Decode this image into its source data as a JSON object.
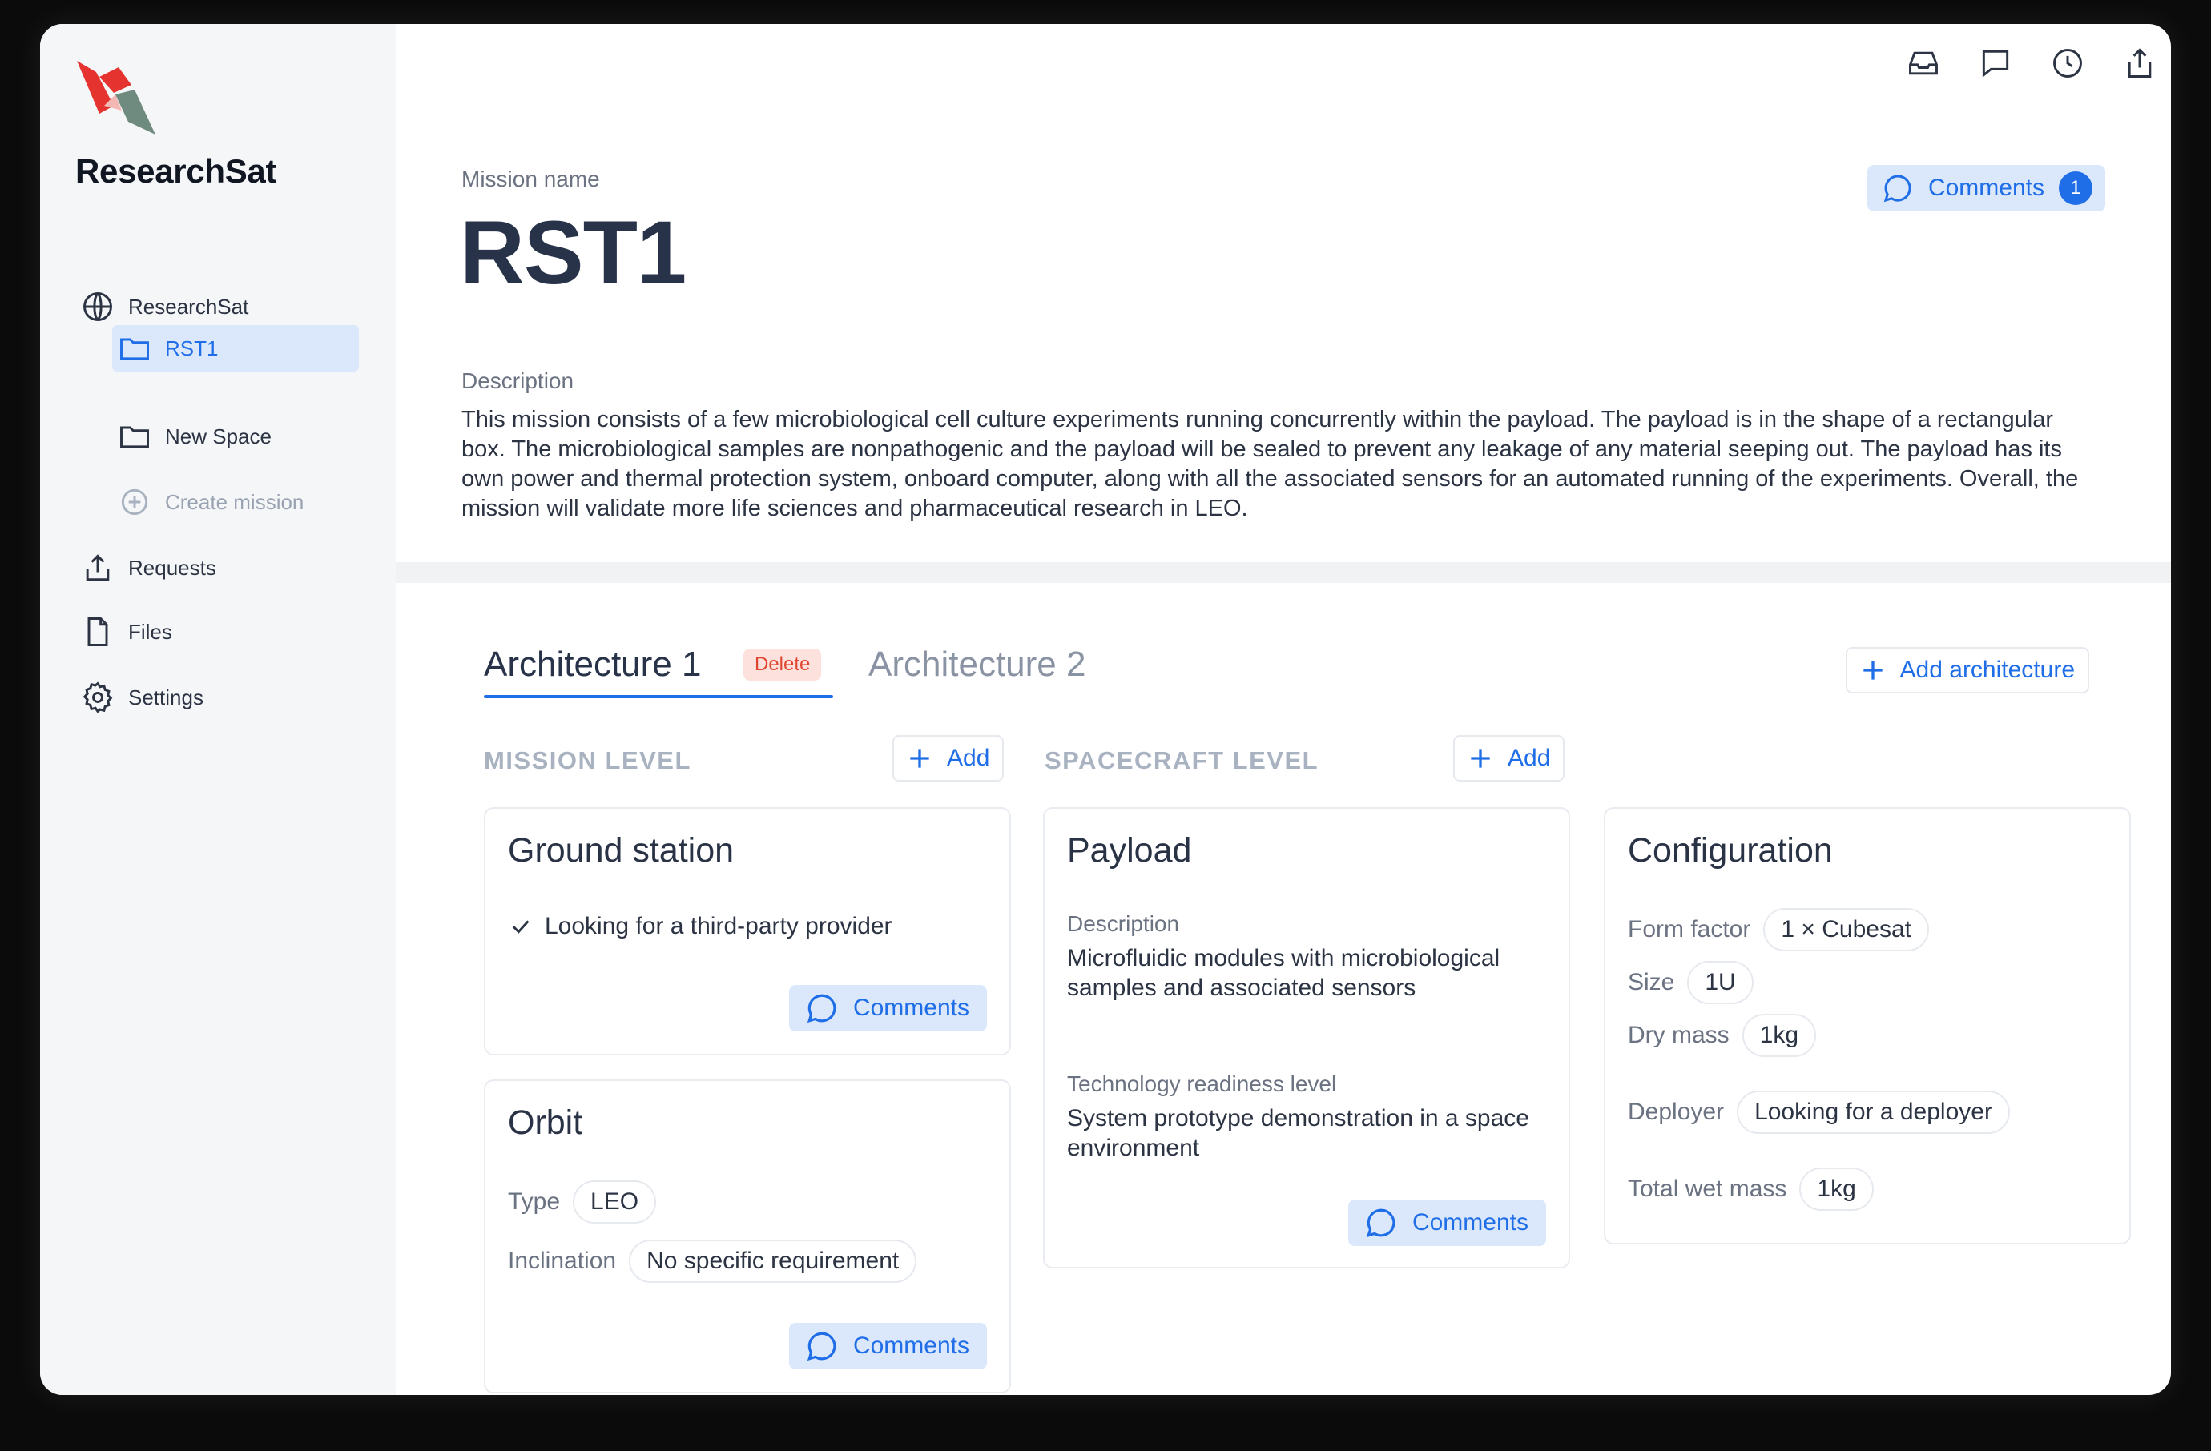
{
  "sidebar": {
    "brand": "ResearchSat",
    "items": [
      {
        "label": "ResearchSat",
        "icon": "globe-icon"
      },
      {
        "label": "RST1",
        "icon": "folder-icon",
        "active": true
      },
      {
        "label": "New Space",
        "icon": "folder-icon"
      },
      {
        "label": "Create mission",
        "icon": "plus-circle-icon"
      },
      {
        "label": "Requests",
        "icon": "upload-icon"
      },
      {
        "label": "Files",
        "icon": "file-icon"
      },
      {
        "label": "Settings",
        "icon": "gear-icon"
      }
    ]
  },
  "topbar": {
    "icons": [
      "inbox-icon",
      "chat-icon",
      "clock-icon",
      "share-icon"
    ]
  },
  "mission": {
    "name_label": "Mission name",
    "name": "RST1",
    "comments_label": "Comments",
    "comments_count": "1",
    "description_label": "Description",
    "description": "This mission consists of a few microbiological cell culture experiments running concurrently within the payload. The payload is in the shape of a rectangular box. The microbiological samples are nonpathogenic and the payload will be sealed to prevent any leakage of any material seeping out. The payload has its own power and thermal protection system, onboard computer, along with all the associated sensors for an automated running of the experiments. Overall, the mission will validate more life sciences and pharmaceutical research in LEO."
  },
  "tabs": {
    "tab1": "Architecture 1",
    "delete_label": "Delete",
    "tab2": "Architecture 2",
    "add_architecture": "Add architecture"
  },
  "sections": {
    "mission_level": "MISSION LEVEL",
    "spacecraft_level": "SPACECRAFT LEVEL",
    "add_label": "Add"
  },
  "cards": {
    "ground_station": {
      "title": "Ground station",
      "check_item": "Looking for a third-party provider",
      "comments_label": "Comments"
    },
    "orbit": {
      "title": "Orbit",
      "type_label": "Type",
      "type_value": "LEO",
      "inclination_label": "Inclination",
      "inclination_value": "No specific requirement",
      "comments_label": "Comments"
    },
    "payload": {
      "title": "Payload",
      "description_label": "Description",
      "description": "Microfluidic modules with microbiological samples and associated sensors",
      "trl_label": "Technology readiness level",
      "trl_value": "System prototype demonstration in a space environment",
      "comments_label": "Comments"
    },
    "configuration": {
      "title": "Configuration",
      "form_factor_label": "Form factor",
      "form_factor_value": "1 × Cubesat",
      "size_label": "Size",
      "size_value": "1U",
      "dry_mass_label": "Dry mass",
      "dry_mass_value": "1kg",
      "deployer_label": "Deployer",
      "deployer_value": "Looking for a deployer",
      "wet_mass_label": "Total wet mass",
      "wet_mass_value": "1kg"
    }
  },
  "colors": {
    "accent": "#1f6ee8",
    "accent_soft": "#dbe8fb",
    "danger": "#e0462f",
    "logo_red": "#e5342f",
    "logo_gray": "#6f8a7e"
  }
}
